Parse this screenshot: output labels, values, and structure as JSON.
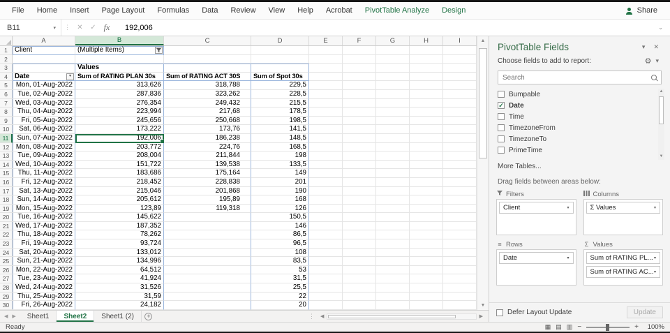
{
  "colors": {
    "accent": "#217346",
    "pivot_border": "#9ab5dc",
    "header_select": "#d4e8d8"
  },
  "ribbon": {
    "tabs": [
      {
        "label": "File",
        "green": false
      },
      {
        "label": "Home",
        "green": false
      },
      {
        "label": "Insert",
        "green": false
      },
      {
        "label": "Page Layout",
        "green": false
      },
      {
        "label": "Formulas",
        "green": false
      },
      {
        "label": "Data",
        "green": false
      },
      {
        "label": "Review",
        "green": false
      },
      {
        "label": "View",
        "green": false
      },
      {
        "label": "Help",
        "green": false
      },
      {
        "label": "Acrobat",
        "green": false
      },
      {
        "label": "PivotTable Analyze",
        "green": true
      },
      {
        "label": "Design",
        "green": true
      }
    ],
    "share": "Share"
  },
  "formula_bar": {
    "name_box": "B11",
    "cancel": "✕",
    "enter": "✓",
    "fx": "fx",
    "value": "192,006"
  },
  "sheet": {
    "columns": [
      "A",
      "B",
      "C",
      "D",
      "E",
      "F",
      "G",
      "H",
      "I"
    ],
    "row_count": 30,
    "selected": {
      "cell": "B11",
      "col": "B",
      "row": 11
    },
    "pivot": {
      "filter_label": "Client",
      "filter_value": "(Multiple Items)",
      "values_label": "Values",
      "row_header": "Date",
      "col_headers": [
        "Sum of RATING PLAN 30s",
        "Sum of RATING ACT 30S",
        "Sum of Spot 30s"
      ],
      "rows": [
        {
          "date": "Mon, 01-Aug-2022",
          "plan": "313,626",
          "act": "318,788",
          "spot": "229,5"
        },
        {
          "date": "Tue, 02-Aug-2022",
          "plan": "287,836",
          "act": "323,262",
          "spot": "228,5"
        },
        {
          "date": "Wed, 03-Aug-2022",
          "plan": "276,354",
          "act": "249,432",
          "spot": "215,5"
        },
        {
          "date": "Thu, 04-Aug-2022",
          "plan": "223,994",
          "act": "217,68",
          "spot": "178,5"
        },
        {
          "date": "Fri, 05-Aug-2022",
          "plan": "245,656",
          "act": "250,668",
          "spot": "198,5"
        },
        {
          "date": "Sat, 06-Aug-2022",
          "plan": "173,222",
          "act": "173,76",
          "spot": "141,5"
        },
        {
          "date": "Sun, 07-Aug-2022",
          "plan": "192,006",
          "act": "186,238",
          "spot": "148,5"
        },
        {
          "date": "Mon, 08-Aug-2022",
          "plan": "203,772",
          "act": "224,76",
          "spot": "168,5"
        },
        {
          "date": "Tue, 09-Aug-2022",
          "plan": "208,004",
          "act": "211,844",
          "spot": "198"
        },
        {
          "date": "Wed, 10-Aug-2022",
          "plan": "151,722",
          "act": "139,538",
          "spot": "133,5"
        },
        {
          "date": "Thu, 11-Aug-2022",
          "plan": "183,686",
          "act": "175,164",
          "spot": "149"
        },
        {
          "date": "Fri, 12-Aug-2022",
          "plan": "218,452",
          "act": "228,838",
          "spot": "201"
        },
        {
          "date": "Sat, 13-Aug-2022",
          "plan": "215,046",
          "act": "201,868",
          "spot": "190"
        },
        {
          "date": "Sun, 14-Aug-2022",
          "plan": "205,612",
          "act": "195,89",
          "spot": "168"
        },
        {
          "date": "Mon, 15-Aug-2022",
          "plan": "123,89",
          "act": "119,318",
          "spot": "126"
        },
        {
          "date": "Tue, 16-Aug-2022",
          "plan": "145,622",
          "act": "",
          "spot": "150,5"
        },
        {
          "date": "Wed, 17-Aug-2022",
          "plan": "187,352",
          "act": "",
          "spot": "146"
        },
        {
          "date": "Thu, 18-Aug-2022",
          "plan": "78,262",
          "act": "",
          "spot": "86,5"
        },
        {
          "date": "Fri, 19-Aug-2022",
          "plan": "93,724",
          "act": "",
          "spot": "96,5"
        },
        {
          "date": "Sat, 20-Aug-2022",
          "plan": "133,012",
          "act": "",
          "spot": "108"
        },
        {
          "date": "Sun, 21-Aug-2022",
          "plan": "134,996",
          "act": "",
          "spot": "83,5"
        },
        {
          "date": "Mon, 22-Aug-2022",
          "plan": "64,512",
          "act": "",
          "spot": "53"
        },
        {
          "date": "Tue, 23-Aug-2022",
          "plan": "41,924",
          "act": "",
          "spot": "31,5"
        },
        {
          "date": "Wed, 24-Aug-2022",
          "plan": "31,526",
          "act": "",
          "spot": "25,5"
        },
        {
          "date": "Thu, 25-Aug-2022",
          "plan": "31,59",
          "act": "",
          "spot": "22"
        },
        {
          "date": "Fri, 26-Aug-2022",
          "plan": "24,182",
          "act": "",
          "spot": "20"
        }
      ]
    },
    "tabs": [
      "Sheet1",
      "Sheet2",
      "Sheet1 (2)"
    ],
    "active_tab": "Sheet2"
  },
  "pane": {
    "title": "PivotTable Fields",
    "subtitle": "Choose fields to add to report:",
    "search_placeholder": "Search",
    "fields": [
      {
        "label": "Bumpable",
        "checked": false
      },
      {
        "label": "Date",
        "checked": true
      },
      {
        "label": "Time",
        "checked": false
      },
      {
        "label": "TimezoneFrom",
        "checked": false
      },
      {
        "label": "TimezoneTo",
        "checked": false
      },
      {
        "label": "PrimeTime",
        "checked": false
      }
    ],
    "more_tables": "More Tables...",
    "drag_label": "Drag fields between areas below:",
    "areas": {
      "filters": {
        "label": "Filters",
        "items": [
          "Client"
        ]
      },
      "columns": {
        "label": "Columns",
        "items": [
          "Σ Values"
        ]
      },
      "rows": {
        "label": "Rows",
        "items": [
          "Date"
        ]
      },
      "values": {
        "label": "Values",
        "items": [
          "Sum of RATING PL...",
          "Sum of RATING AC..."
        ]
      }
    },
    "defer_label": "Defer Layout Update",
    "update_label": "Update"
  },
  "status_bar": {
    "ready": "Ready",
    "zoom": "100%"
  }
}
